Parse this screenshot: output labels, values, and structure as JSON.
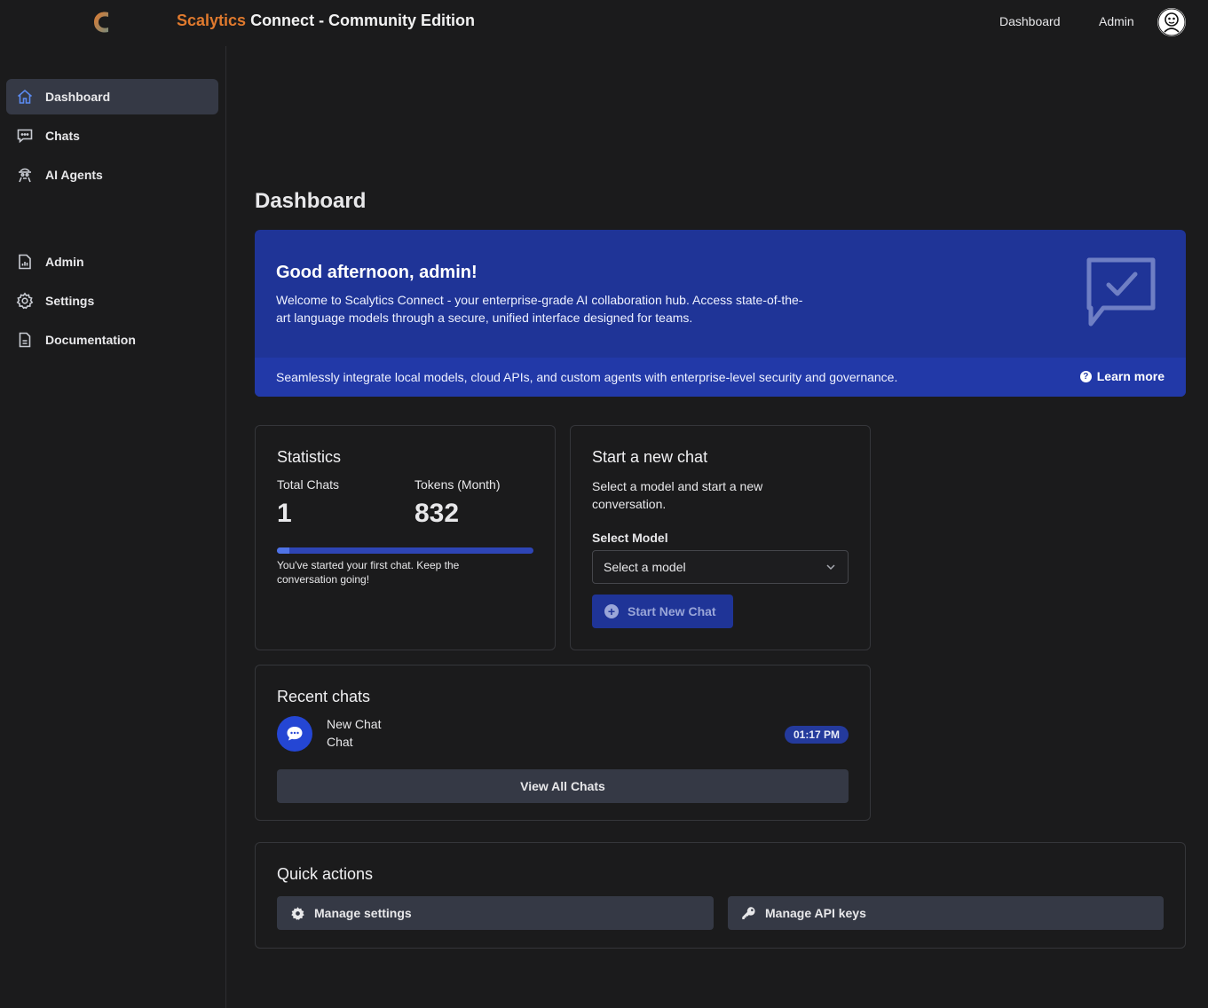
{
  "header": {
    "brand": "Scalytics",
    "title_rest": " Connect - Community Edition",
    "nav": {
      "dashboard": "Dashboard",
      "admin": "Admin"
    }
  },
  "sidebar": {
    "items": [
      {
        "label": "Dashboard",
        "icon": "home-icon",
        "active": true
      },
      {
        "label": "Chats",
        "icon": "chat-bubble-icon"
      },
      {
        "label": "AI Agents",
        "icon": "agent-icon"
      },
      {
        "label": "Admin",
        "icon": "report-icon"
      },
      {
        "label": "Settings",
        "icon": "gear-icon"
      },
      {
        "label": "Documentation",
        "icon": "document-icon"
      }
    ]
  },
  "main": {
    "page_title": "Dashboard",
    "hero": {
      "greeting": "Good afternoon, admin!",
      "text": "Welcome to Scalytics Connect - your enterprise-grade AI collaboration hub. Access state-of-the-art language models through a secure, unified interface designed for teams.",
      "footer_text": "Seamlessly integrate local models, cloud APIs, and custom agents with enterprise-level security and governance.",
      "learn_more": "Learn more"
    },
    "statistics": {
      "title": "Statistics",
      "total_chats_label": "Total Chats",
      "total_chats_value": "1",
      "tokens_label": "Tokens (Month)",
      "tokens_value": "832",
      "progress_fraction": 0.05,
      "note": "You've started your first chat. Keep the conversation going!"
    },
    "new_chat": {
      "title": "Start a new chat",
      "description": "Select a model and start a new conversation.",
      "select_label": "Select Model",
      "select_value": "Select a model",
      "button": "Start New Chat"
    },
    "recent_chats": {
      "title": "Recent chats",
      "items": [
        {
          "title": "New Chat",
          "subtitle": "Chat",
          "time": "01:17 PM"
        }
      ],
      "view_all": "View All Chats"
    },
    "quick_actions": {
      "title": "Quick actions",
      "settings": "Manage settings",
      "api_keys": "Manage API keys"
    }
  },
  "colors": {
    "accent_orange": "#e07a2e",
    "hero_blue": "#1f3497",
    "active_blue": "#5b8af0",
    "background": "#1b1b1c"
  }
}
